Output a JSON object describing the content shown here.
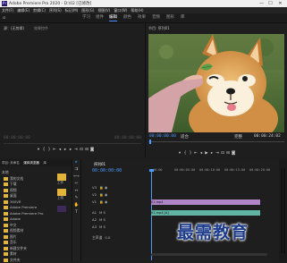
{
  "window": {
    "title": "Adobe Premiere Pro 2020 - D:\\02 [已修改]",
    "minimize": "—",
    "maximize": "☐",
    "close": "✕"
  },
  "menu": [
    "文件(F)",
    "编辑(E)",
    "剪辑(C)",
    "序列(S)",
    "标记(M)",
    "图形(G)",
    "视图(V)",
    "窗口(W)",
    "帮助(H)"
  ],
  "workspaces": {
    "home_icon": "home-icon",
    "items": [
      "学习",
      "组件",
      "编辑",
      "颜色",
      "效果",
      "音频",
      "图形",
      "库"
    ],
    "active": "编辑"
  },
  "source_panel": {
    "tab1": "源：(无剪辑)",
    "tab2": "效果控件",
    "timecode_left": "00:00:00:00",
    "timecode_right": "00:00:00:00"
  },
  "program_panel": {
    "tab": "节目: 序列01",
    "timecode": "00:00:00:00",
    "fit": "适合",
    "quality": "完整",
    "duration": "00:00:24:02"
  },
  "project_panel": {
    "tabs": [
      "项目: 未命名",
      "媒体浏览器",
      "库"
    ],
    "items": [
      "本地",
      "我的文档",
      "下载",
      "视频",
      "桌面",
      "360VR",
      "Adobe Premiere",
      "Adobe Premiere Pro",
      "Adobe",
      "中文",
      "视频素材",
      "图片",
      "音乐",
      "新建文件夹",
      "素材",
      "文件夹"
    ],
    "media_label1": "工作",
    "media_label2": "上线"
  },
  "timeline": {
    "tab": "序列01",
    "timecode": "00:00:00:00",
    "ruler": [
      "00:00",
      "00:00:05:00",
      "00:00:10:00",
      "00:00:15:00",
      "00:00:20:00"
    ],
    "tracks": [
      {
        "name": "V3",
        "icons": "🔒 ◉"
      },
      {
        "name": "V2",
        "icons": "🔒 ◉"
      },
      {
        "name": "V1",
        "icons": "🔒 ◉"
      },
      {
        "name": "A1",
        "icons": "M S"
      },
      {
        "name": "A2",
        "icons": "M S"
      },
      {
        "name": "A3",
        "icons": "M S"
      },
      {
        "name": "主声道",
        "icons": "0.0"
      }
    ],
    "clips": {
      "video": "01.mp4",
      "audio": "01.mp4 [A]"
    }
  },
  "watermark": "最需教育",
  "colors": {
    "accent": "#4b9bff",
    "video_clip": "#b084c8",
    "audio_clip": "#5fb4a4",
    "folder": "#e3b43b"
  }
}
